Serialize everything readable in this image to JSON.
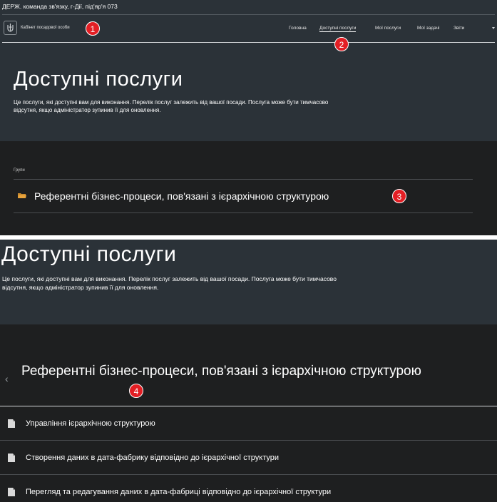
{
  "header": {
    "org_line": "ДЕРЖ. команда зв'язку, г-Дії, під'яр'я 073",
    "cabinet": "Кабінет посадової особи"
  },
  "nav": {
    "items": [
      {
        "label": "Головна",
        "active": false
      },
      {
        "label": "Доступні послуги",
        "active": true
      },
      {
        "label": "Мої послуги",
        "active": false
      },
      {
        "label": "Мої задачі",
        "active": false
      },
      {
        "label": "Звіти",
        "active": false
      }
    ]
  },
  "page": {
    "title": "Доступні послуги",
    "description_top": "Це послуги, які доступні вам для виконання. Перелік послуг залежить від вашої посади. Послуга може бути тимчасово відсутня, якщо адміністратор зупинив її для оновлення.",
    "description_bottom": "Це послуги, які доступні вам для виконання. Перелік послуг залежить від вашої посади. Послуга може бути тимчасово відсутня, якщо адміністратор зупинив її для оновлення."
  },
  "groups": {
    "label": "Групи",
    "items": [
      {
        "title": "Референтні бізнес-процеси, пов'язані з ієрархічною структурою"
      }
    ]
  },
  "group_detail": {
    "title": "Референтні бізнес-процеси, пов'язані з ієрархічною структурою",
    "services": [
      {
        "label": "Управління ієрархічною структурою"
      },
      {
        "label": "Створення даних в дата-фабрику відповідно до ієрархічної структури"
      },
      {
        "label": "Перегляд та редагування даних в дата-фабриці відповідно до ієрархічної структури"
      }
    ]
  },
  "badges": [
    "1",
    "2",
    "3",
    "4"
  ],
  "colors": {
    "header_bg": "#2b3238",
    "content_bg": "#1e1f20",
    "badge": "#e31e24",
    "folder": "#e8a33c"
  },
  "icons": [
    "trident-emblem-icon",
    "chevron-down-icon",
    "folder-icon",
    "chevron-left-icon",
    "document-icon"
  ]
}
